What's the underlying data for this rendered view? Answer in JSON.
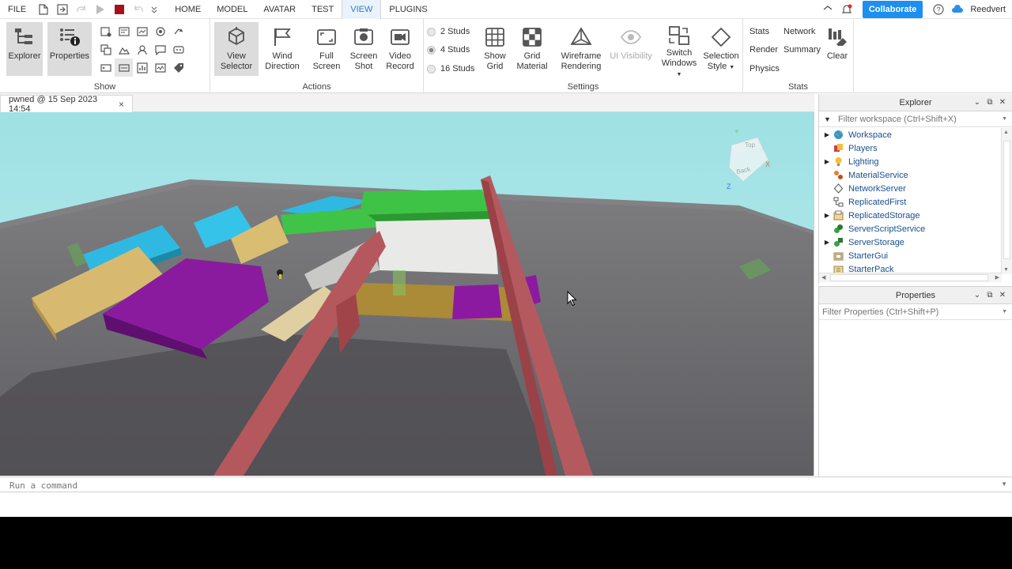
{
  "menubar": {
    "file": "FILE",
    "tabs": [
      "HOME",
      "MODEL",
      "AVATAR",
      "TEST",
      "VIEW",
      "PLUGINS"
    ],
    "active_tab": "VIEW",
    "collaborate": "Collaborate",
    "username": "Reedvert"
  },
  "ribbon": {
    "show": {
      "label": "Show",
      "explorer": "Explorer",
      "properties": "Properties"
    },
    "actions": {
      "label": "Actions",
      "view_selector": [
        "View",
        "Selector"
      ],
      "wind_direction": [
        "Wind",
        "Direction"
      ],
      "full_screen": [
        "Full",
        "Screen"
      ],
      "screen_shot": [
        "Screen",
        "Shot"
      ],
      "video_record": [
        "Video",
        "Record"
      ]
    },
    "settings": {
      "label": "Settings",
      "studs": [
        "2 Studs",
        "4 Studs",
        "16 Studs"
      ],
      "selected_studs": "4 Studs",
      "show_grid": [
        "Show",
        "Grid"
      ],
      "grid_material": [
        "Grid",
        "Material"
      ],
      "wireframe": [
        "Wireframe",
        "Rendering"
      ],
      "ui_visibility": "UI Visibility",
      "switch_windows": [
        "Switch",
        "Windows"
      ],
      "selection_style": [
        "Selection",
        "Style"
      ]
    },
    "stats": {
      "label": "Stats",
      "stats": "Stats",
      "network": "Network",
      "render": "Render",
      "summary": "Summary",
      "physics": "Physics",
      "clear": "Clear"
    }
  },
  "document_tab": {
    "title": "pwned @ 15 Sep 2023 14:54",
    "close": "×"
  },
  "command_bar": {
    "placeholder": "Run a command"
  },
  "explorer": {
    "title": "Explorer",
    "filter_placeholder": "Filter workspace (Ctrl+Shift+X)",
    "items": [
      {
        "label": "Workspace",
        "expandable": true,
        "icon": "globe-icon"
      },
      {
        "label": "Players",
        "expandable": false,
        "icon": "players-icon"
      },
      {
        "label": "Lighting",
        "expandable": true,
        "icon": "lightbulb-icon"
      },
      {
        "label": "MaterialService",
        "expandable": false,
        "icon": "material-service-icon"
      },
      {
        "label": "NetworkServer",
        "expandable": false,
        "icon": "network-server-icon"
      },
      {
        "label": "ReplicatedFirst",
        "expandable": false,
        "icon": "replicated-first-icon"
      },
      {
        "label": "ReplicatedStorage",
        "expandable": true,
        "icon": "replicated-storage-icon"
      },
      {
        "label": "ServerScriptService",
        "expandable": false,
        "icon": "server-script-service-icon"
      },
      {
        "label": "ServerStorage",
        "expandable": true,
        "icon": "server-storage-icon"
      },
      {
        "label": "StarterGui",
        "expandable": false,
        "icon": "starter-gui-icon"
      },
      {
        "label": "StarterPack",
        "expandable": false,
        "icon": "starter-pack-icon"
      }
    ]
  },
  "properties": {
    "title": "Properties",
    "filter_placeholder": "Filter Properties (Ctrl+Shift+P)"
  },
  "viewcube": {
    "top_label": "Top",
    "back_label": "Back",
    "x_axis": "X",
    "z_axis": "Z"
  },
  "colors": {
    "accent": "#1d8ff0",
    "sky": "#a9e3e6",
    "baseplate": "#6b6a6e",
    "red_part": "#b85459",
    "purple_part": "#8b1a9c",
    "blue_part": "#2eb8e0",
    "green_part": "#3cbb45",
    "tan_part": "#d2b56d"
  }
}
